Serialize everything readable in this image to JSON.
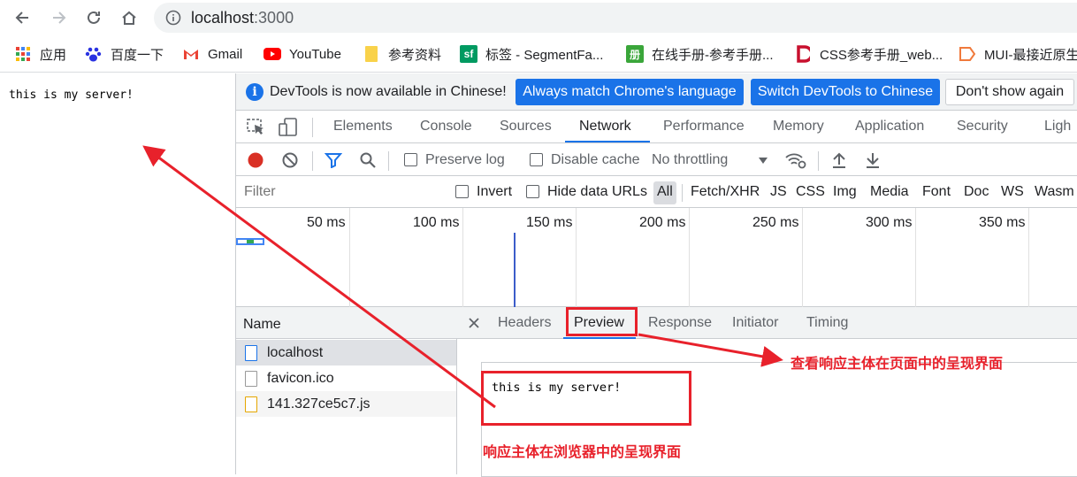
{
  "browser": {
    "url_host": "localhost",
    "url_port": ":3000",
    "bookmarks": [
      {
        "label": "应用",
        "icon": "apps-grid-icon"
      },
      {
        "label": "百度一下",
        "icon": "baidu-paw-icon"
      },
      {
        "label": "Gmail",
        "icon": "gmail-icon"
      },
      {
        "label": "YouTube",
        "icon": "youtube-icon"
      },
      {
        "label": "参考资料",
        "icon": "folder-icon"
      },
      {
        "label": "标签 - SegmentFa...",
        "icon": "segmentfault-icon"
      },
      {
        "label": "在线手册-参考手册...",
        "icon": "manual-icon"
      },
      {
        "label": "CSS参考手册_web...",
        "icon": "css-manual-icon"
      },
      {
        "label": "MUI-最接近原生",
        "icon": "mui-icon"
      }
    ]
  },
  "page": {
    "body_text": "this is my server!"
  },
  "devtools": {
    "infobar": {
      "message": "DevTools is now available in Chinese!",
      "btn_match": "Always match Chrome's language",
      "btn_switch": "Switch DevTools to Chinese",
      "btn_dismiss": "Don't show again"
    },
    "tabs": [
      "Elements",
      "Console",
      "Sources",
      "Network",
      "Performance",
      "Memory",
      "Application",
      "Security",
      "Ligh"
    ],
    "active_tab": "Network",
    "toolbar": {
      "preserve_log": "Preserve log",
      "disable_cache": "Disable cache",
      "throttling": "No throttling"
    },
    "filter": {
      "placeholder": "Filter",
      "invert": "Invert",
      "hide_data_urls": "Hide data URLs",
      "types": [
        "All",
        "Fetch/XHR",
        "JS",
        "CSS",
        "Img",
        "Media",
        "Font",
        "Doc",
        "WS",
        "Wasm"
      ]
    },
    "timeline_ticks": [
      "50 ms",
      "100 ms",
      "150 ms",
      "200 ms",
      "250 ms",
      "300 ms",
      "350 ms"
    ],
    "name_header": "Name",
    "requests": [
      {
        "name": "localhost",
        "type": "document"
      },
      {
        "name": "favicon.ico",
        "type": "file"
      },
      {
        "name": "141.327ce5c7.js",
        "type": "script"
      }
    ],
    "detail_tabs": [
      "Headers",
      "Preview",
      "Response",
      "Initiator",
      "Timing"
    ],
    "active_detail_tab": "Preview",
    "preview_text": "this is my server!"
  },
  "annotations": {
    "preview_note": "查看响应主体在页面中的呈现界面",
    "browser_note": "响应主体在浏览器中的呈现界面"
  },
  "colors": {
    "accent_blue": "#1a73e8",
    "annotation_red": "#e8212b",
    "record_red": "#d93025"
  }
}
